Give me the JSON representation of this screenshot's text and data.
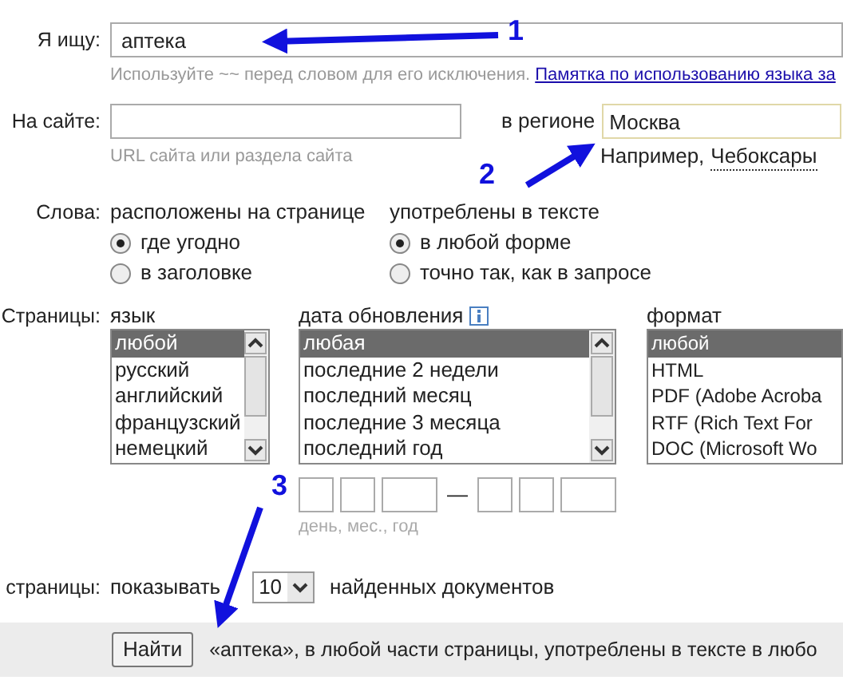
{
  "query": {
    "label": "Я ищу:",
    "value": "аптека",
    "hint": "Используйте ~~ перед словом для его исключения.",
    "hint_link": "Памятка по использованию языка за"
  },
  "site": {
    "label": "На сайте:",
    "hint": "URL сайта или раздела сайта",
    "region_label": "в регионе",
    "region_value": "Москва",
    "example_prefix": "Например,",
    "example_link": "Чебоксары"
  },
  "words": {
    "label": "Слова:",
    "groups": [
      {
        "title": "расположены на странице",
        "options": [
          {
            "label": "где угодно",
            "selected": true
          },
          {
            "label": "в заголовке",
            "selected": false
          }
        ]
      },
      {
        "title": "употреблены в тексте",
        "options": [
          {
            "label": "в любой форме",
            "selected": true
          },
          {
            "label": "точно так, как в запросе",
            "selected": false
          }
        ]
      }
    ]
  },
  "pages": {
    "label": "Страницы:",
    "lists": [
      {
        "title": "язык",
        "info": false,
        "items": [
          {
            "label": "любой",
            "selected": true
          },
          {
            "label": "русский",
            "selected": false
          },
          {
            "label": "английский",
            "selected": false
          },
          {
            "label": "французский",
            "selected": false
          },
          {
            "label": "немецкий",
            "selected": false
          }
        ]
      },
      {
        "title": "дата обновления",
        "info": true,
        "items": [
          {
            "label": "любая",
            "selected": true
          },
          {
            "label": "последние 2 недели",
            "selected": false
          },
          {
            "label": "последний месяц",
            "selected": false
          },
          {
            "label": "последние 3 месяца",
            "selected": false
          },
          {
            "label": "последний год",
            "selected": false
          }
        ]
      },
      {
        "title": "формат",
        "info": false,
        "items": [
          {
            "label": "любой",
            "selected": true
          },
          {
            "label": "HTML",
            "selected": false
          },
          {
            "label": "PDF (Adobe Acroba",
            "selected": false
          },
          {
            "label": "RTF (Rich Text For",
            "selected": false
          },
          {
            "label": "DOC (Microsoft Wo",
            "selected": false
          }
        ]
      }
    ],
    "date_separator": "—",
    "date_hint": "день, мес., год"
  },
  "results": {
    "label": "страницы:",
    "prefix": "показывать",
    "count": "10",
    "suffix": "найденных документов"
  },
  "footer": {
    "button": "Найти",
    "summary": "«аптека», в любой части страницы, употреблены в тексте в любо"
  },
  "annotations": [
    {
      "number": "1"
    },
    {
      "number": "2"
    },
    {
      "number": "3"
    }
  ]
}
